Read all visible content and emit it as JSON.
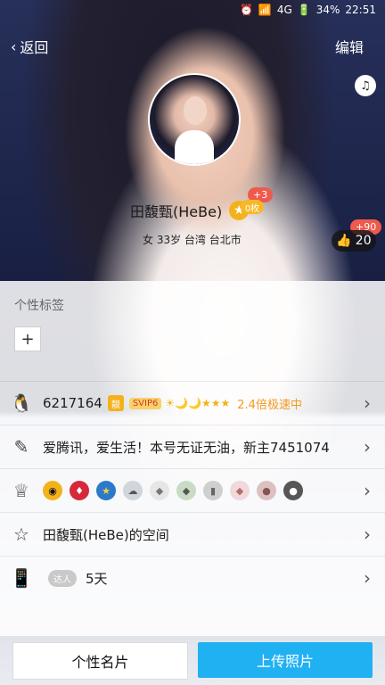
{
  "status": {
    "time": "22:51",
    "battery": "34%",
    "network": "4G"
  },
  "topbar": {
    "back_label": "返回",
    "edit_label": "编辑"
  },
  "profile": {
    "name": "田馥甄(HeBe)",
    "sub": "女 33岁 台湾 台北市",
    "plus_badge": "+3",
    "coin_label": "0枚",
    "likes": "20",
    "likes_plus": "+90"
  },
  "tags": {
    "title": "个性标签",
    "add": "+"
  },
  "rows": {
    "qq": {
      "number": "6217164",
      "cute": "靓",
      "svip": "SVIP6",
      "speed": "2.4倍极速中"
    },
    "signature": "爱腾讯，爱生活！本号无证无油，新主7451074",
    "badges_label": "",
    "space": "田馥甄(HeBe)的空间",
    "days": {
      "tag": "达人",
      "value": "5天"
    }
  },
  "buttons": {
    "card": "个性名片",
    "upload": "上传照片"
  },
  "colors": {
    "accent": "#20b1f3",
    "badge_red": "#ef5a4d",
    "gold": "#f3b21c"
  }
}
